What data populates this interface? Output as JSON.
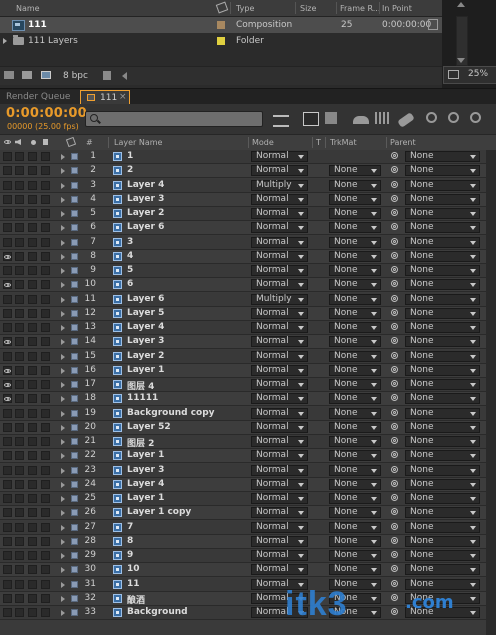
{
  "project": {
    "columns": {
      "name": "Name",
      "type": "Type",
      "size": "Size",
      "frame_rate": "Frame R...",
      "in_point": "In Point"
    },
    "items": [
      {
        "name": "111",
        "type": "Composition",
        "size": "",
        "frame_rate": "25",
        "in_point": "0:00:00:00",
        "swatch": "#a88860",
        "kind": "composition"
      },
      {
        "name": "111 Layers",
        "type": "Folder",
        "size": "",
        "frame_rate": "",
        "in_point": "",
        "swatch": "#e0d040",
        "kind": "folder"
      }
    ],
    "bit_depth": "8 bpc",
    "zoom": "25%"
  },
  "tabs": {
    "render_queue": "Render Queue",
    "comp": "111",
    "close": "×"
  },
  "timeline": {
    "timecode": "0:00:00:00",
    "frames": "00000 (25.00 fps)",
    "search_placeholder": ""
  },
  "columns": {
    "num": "#",
    "layer_name": "Layer Name",
    "mode": "Mode",
    "t": "T",
    "trkmat": "TrkMat",
    "parent": "Parent"
  },
  "layers": [
    {
      "num": "1",
      "name": "1",
      "mode": "Normal",
      "trkmat": "",
      "parent": "None",
      "eye": false
    },
    {
      "num": "2",
      "name": "2",
      "mode": "Normal",
      "trkmat": "None",
      "parent": "None",
      "eye": false
    },
    {
      "num": "3",
      "name": "Layer 4",
      "mode": "Multiply",
      "trkmat": "None",
      "parent": "None",
      "eye": false
    },
    {
      "num": "4",
      "name": "Layer 3",
      "mode": "Normal",
      "trkmat": "None",
      "parent": "None",
      "eye": false
    },
    {
      "num": "5",
      "name": "Layer 2",
      "mode": "Normal",
      "trkmat": "None",
      "parent": "None",
      "eye": false
    },
    {
      "num": "6",
      "name": "Layer 6",
      "mode": "Normal",
      "trkmat": "None",
      "parent": "None",
      "eye": false
    },
    {
      "num": "7",
      "name": "3",
      "mode": "Normal",
      "trkmat": "None",
      "parent": "None",
      "eye": false
    },
    {
      "num": "8",
      "name": "4",
      "mode": "Normal",
      "trkmat": "None",
      "parent": "None",
      "eye": true
    },
    {
      "num": "9",
      "name": "5",
      "mode": "Normal",
      "trkmat": "None",
      "parent": "None",
      "eye": false
    },
    {
      "num": "10",
      "name": "6",
      "mode": "Normal",
      "trkmat": "None",
      "parent": "None",
      "eye": true
    },
    {
      "num": "11",
      "name": "Layer 6",
      "mode": "Multiply",
      "trkmat": "None",
      "parent": "None",
      "eye": false
    },
    {
      "num": "12",
      "name": "Layer 5",
      "mode": "Normal",
      "trkmat": "None",
      "parent": "None",
      "eye": false
    },
    {
      "num": "13",
      "name": "Layer 4",
      "mode": "Normal",
      "trkmat": "None",
      "parent": "None",
      "eye": false
    },
    {
      "num": "14",
      "name": "Layer 3",
      "mode": "Normal",
      "trkmat": "None",
      "parent": "None",
      "eye": true
    },
    {
      "num": "15",
      "name": "Layer 2",
      "mode": "Normal",
      "trkmat": "None",
      "parent": "None",
      "eye": false
    },
    {
      "num": "16",
      "name": "Layer 1",
      "mode": "Normal",
      "trkmat": "None",
      "parent": "None",
      "eye": true
    },
    {
      "num": "17",
      "name": "图层 4",
      "mode": "Normal",
      "trkmat": "None",
      "parent": "None",
      "eye": true
    },
    {
      "num": "18",
      "name": "11111",
      "mode": "Normal",
      "trkmat": "None",
      "parent": "None",
      "eye": true
    },
    {
      "num": "19",
      "name": "Background copy",
      "mode": "Normal",
      "trkmat": "None",
      "parent": "None",
      "eye": false
    },
    {
      "num": "20",
      "name": "Layer 52",
      "mode": "Normal",
      "trkmat": "None",
      "parent": "None",
      "eye": false
    },
    {
      "num": "21",
      "name": "图层 2",
      "mode": "Normal",
      "trkmat": "None",
      "parent": "None",
      "eye": false
    },
    {
      "num": "22",
      "name": "Layer 1",
      "mode": "Normal",
      "trkmat": "None",
      "parent": "None",
      "eye": false
    },
    {
      "num": "23",
      "name": "Layer 3",
      "mode": "Normal",
      "trkmat": "None",
      "parent": "None",
      "eye": false
    },
    {
      "num": "24",
      "name": "Layer 4",
      "mode": "Normal",
      "trkmat": "None",
      "parent": "None",
      "eye": false
    },
    {
      "num": "25",
      "name": "Layer 1",
      "mode": "Normal",
      "trkmat": "None",
      "parent": "None",
      "eye": false
    },
    {
      "num": "26",
      "name": "Layer 1 copy",
      "mode": "Normal",
      "trkmat": "None",
      "parent": "None",
      "eye": false
    },
    {
      "num": "27",
      "name": "7",
      "mode": "Normal",
      "trkmat": "None",
      "parent": "None",
      "eye": false
    },
    {
      "num": "28",
      "name": "8",
      "mode": "Normal",
      "trkmat": "None",
      "parent": "None",
      "eye": false
    },
    {
      "num": "29",
      "name": "9",
      "mode": "Normal",
      "trkmat": "None",
      "parent": "None",
      "eye": false
    },
    {
      "num": "30",
      "name": "10",
      "mode": "Normal",
      "trkmat": "None",
      "parent": "None",
      "eye": false
    },
    {
      "num": "31",
      "name": "11",
      "mode": "Normal",
      "trkmat": "None",
      "parent": "None",
      "eye": false
    },
    {
      "num": "32",
      "name": "酿酒",
      "mode": "Normal",
      "trkmat": "None",
      "parent": "None",
      "eye": false
    },
    {
      "num": "33",
      "name": "Background",
      "mode": "Normal",
      "trkmat": "None",
      "parent": "None",
      "eye": false
    }
  ],
  "watermark": {
    "text": "itk3",
    "suffix": ".com"
  },
  "colors": {
    "timecode": "#e89a2a",
    "active_tab_border": "#f0a030",
    "layer_icon": "#3b6fa6"
  }
}
